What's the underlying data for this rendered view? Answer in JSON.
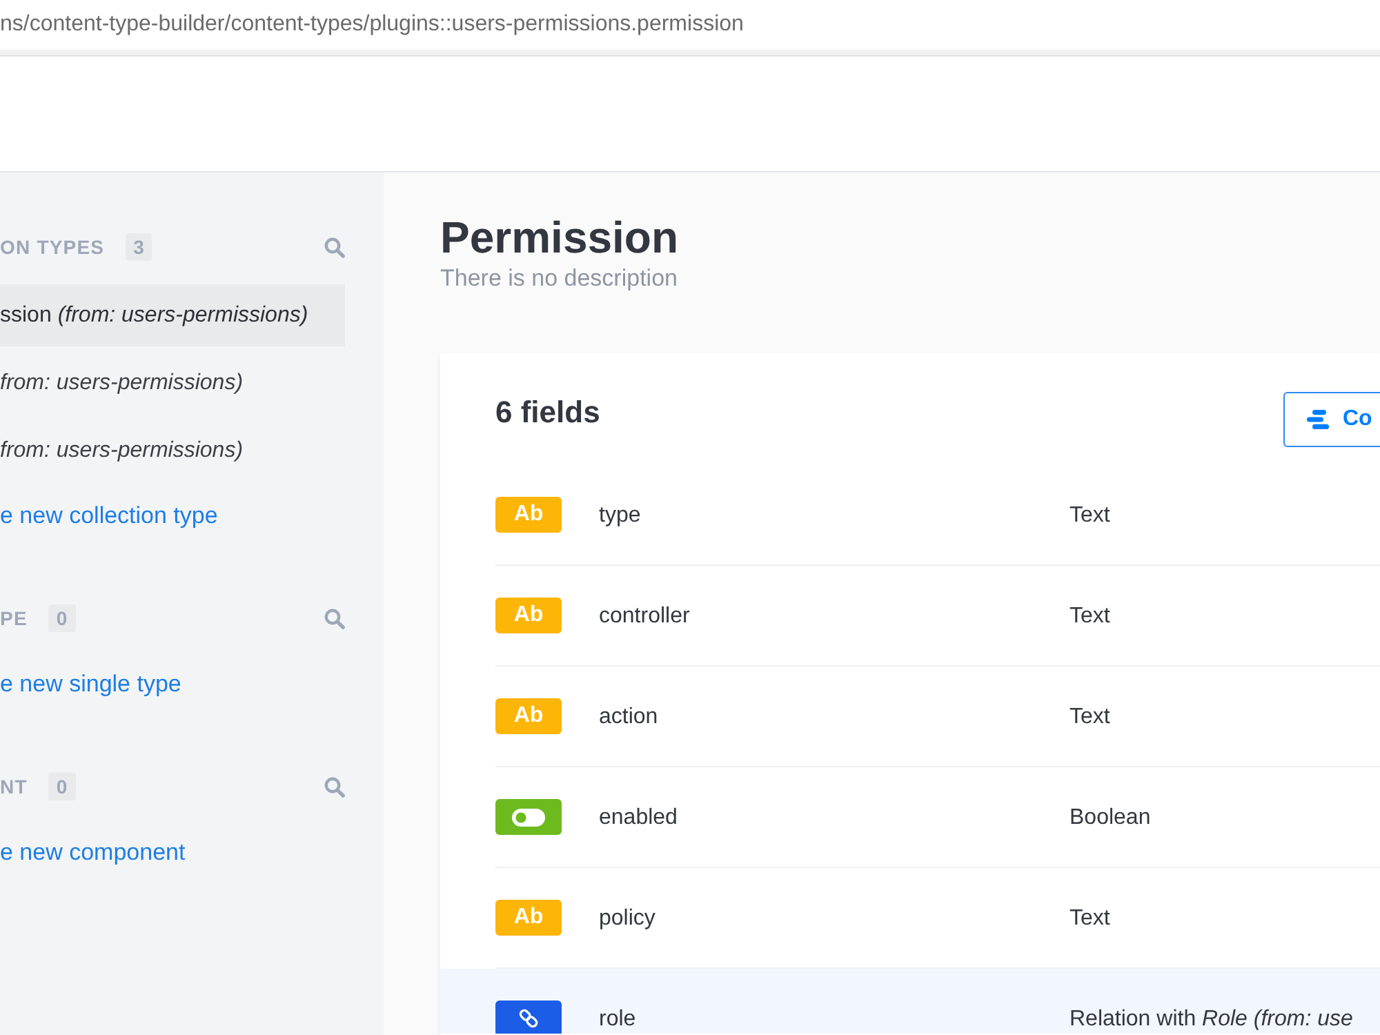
{
  "address_bar": {
    "url": "ns/content-type-builder/content-types/plugins::users-permissions.permission"
  },
  "sidebar": {
    "sections": [
      {
        "title": "ON TYPES",
        "count": "3",
        "items": [
          {
            "name": "ssion",
            "source": "(from: users-permissions)",
            "selected": true
          },
          {
            "source": "from: users-permissions)",
            "selected": false
          },
          {
            "source": "from: users-permissions)",
            "selected": false
          }
        ],
        "link": "e new collection type"
      },
      {
        "title": "PE",
        "count": "0",
        "link": "e new single type"
      },
      {
        "title": "NT",
        "count": "0",
        "link": "e new component"
      }
    ]
  },
  "page": {
    "title": "Permission",
    "description": "There is no description"
  },
  "fields_card": {
    "heading": "6 fields",
    "button": {
      "label": "Co"
    },
    "rows": [
      {
        "kind": "text",
        "badge": "Ab",
        "name": "type",
        "type": "Text",
        "hovered": false
      },
      {
        "kind": "text",
        "badge": "Ab",
        "name": "controller",
        "type": "Text",
        "hovered": false
      },
      {
        "kind": "text",
        "badge": "Ab",
        "name": "action",
        "type": "Text",
        "hovered": false
      },
      {
        "kind": "boolean",
        "name": "enabled",
        "type": "Boolean",
        "hovered": false
      },
      {
        "kind": "text",
        "badge": "Ab",
        "name": "policy",
        "type": "Text",
        "hovered": false
      },
      {
        "kind": "relation",
        "name": "role",
        "type": "Relation with *Role (from: use*",
        "hovered": true
      }
    ]
  }
}
